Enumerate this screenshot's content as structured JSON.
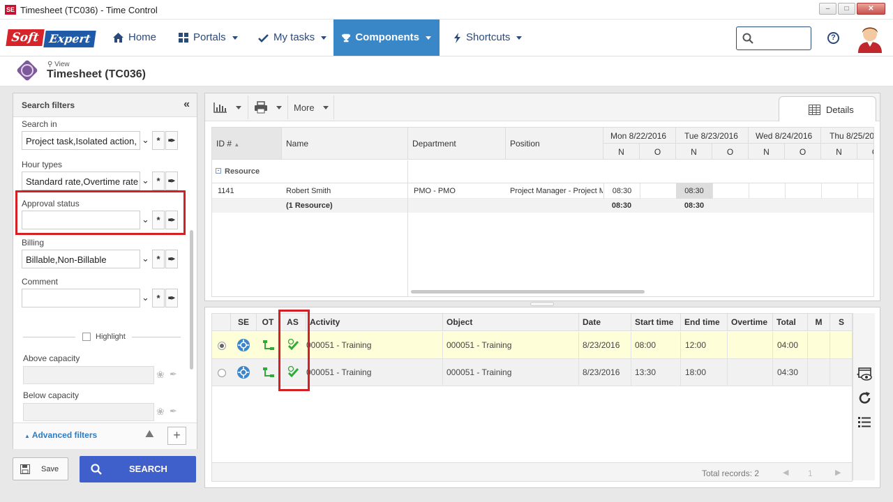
{
  "window": {
    "title": "Timesheet (TC036) - Time Control",
    "app_icon": "SE"
  },
  "nav": {
    "logo_soft": "Soft",
    "logo_expert": "Expert",
    "items": [
      {
        "label": "Home",
        "icon": "home-icon"
      },
      {
        "label": "Portals",
        "icon": "grid-icon"
      },
      {
        "label": "My tasks",
        "icon": "check-icon"
      },
      {
        "label": "Components",
        "icon": "trophy-icon"
      },
      {
        "label": "Shortcuts",
        "icon": "bolt-icon"
      }
    ],
    "help": "?"
  },
  "page": {
    "view_label": "View",
    "title": "Timesheet (TC036)"
  },
  "filters": {
    "header": "Search filters",
    "search_in_label": "Search in",
    "search_in_value": "Project task,Isolated action,",
    "hour_types_label": "Hour types",
    "hour_types_value": "Standard rate,Overtime rate",
    "approval_label": "Approval status",
    "approval_value": "",
    "billing_label": "Billing",
    "billing_value": "Billable,Non-Billable",
    "comment_label": "Comment",
    "comment_value": "",
    "highlight_label": "Highlight",
    "above_label": "Above capacity",
    "below_label": "Below capacity",
    "advanced_label": "Advanced filters"
  },
  "actions": {
    "save_label": "Save",
    "search_label": "SEARCH"
  },
  "toolbar": {
    "more_label": "More",
    "details_label": "Details"
  },
  "grid1": {
    "headers": {
      "id": "ID #",
      "name": "Name",
      "department": "Department",
      "position": "Position"
    },
    "days": [
      {
        "label": "Mon 8/22/2016"
      },
      {
        "label": "Tue 8/23/2016"
      },
      {
        "label": "Wed 8/24/2016"
      },
      {
        "label": "Thu 8/25/20"
      }
    ],
    "sub_n": "N",
    "sub_o": "O",
    "group_label": "Resource",
    "row": {
      "id": "1141",
      "name": "Robert Smith",
      "department": "PMO - PMO",
      "position": "Project Manager - Project M",
      "mon_n": "08:30",
      "tue_n": "08:30"
    },
    "total": {
      "name": "(1 Resource)",
      "mon_n": "08:30",
      "tue_n": "08:30"
    }
  },
  "grid2": {
    "headers": {
      "se": "SE",
      "ot": "OT",
      "as": "AS",
      "activity": "Activity",
      "object": "Object",
      "date": "Date",
      "start": "Start time",
      "end": "End time",
      "overtime": "Overtime",
      "total": "Total",
      "m": "M",
      "s": "S"
    },
    "rows": [
      {
        "activity": "000051 - Training",
        "object": "000051 - Training",
        "date": "8/23/2016",
        "start": "08:00",
        "end": "12:00",
        "total": "04:00"
      },
      {
        "activity": "000051 - Training",
        "object": "000051 - Training",
        "date": "8/23/2016",
        "start": "13:30",
        "end": "18:00",
        "total": "04:30"
      }
    ],
    "total_records": "Total records: 2",
    "page": "1"
  },
  "colors": {
    "accent": "#3a87c8",
    "highlight_row": "#fefed8",
    "red_box": "#d51f25",
    "search_btn": "#3f5fcb"
  }
}
